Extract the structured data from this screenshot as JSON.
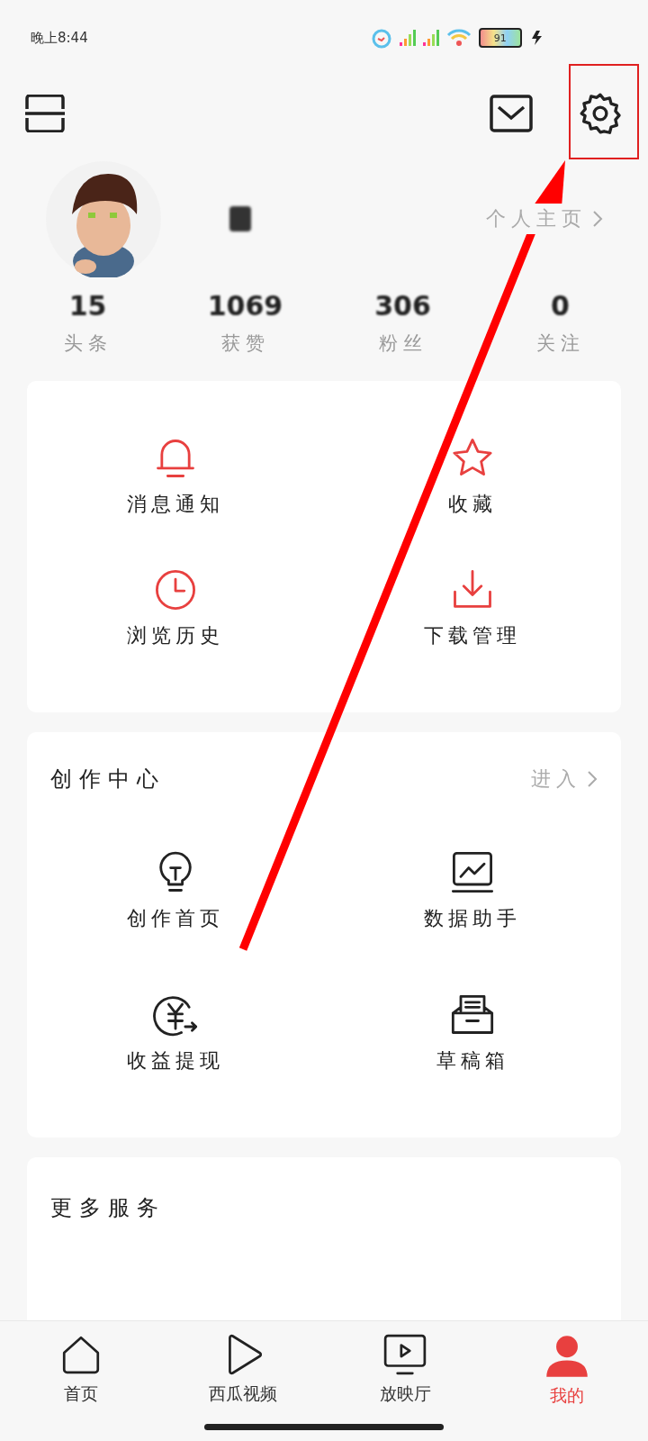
{
  "status_bar": {
    "time": "晚上8:44",
    "battery_label": "91"
  },
  "header": {
    "homepage_link": "个人主页"
  },
  "stats": [
    {
      "value": "15",
      "label": "头条"
    },
    {
      "value": "1069",
      "label": "获赞"
    },
    {
      "value": "306",
      "label": "粉丝"
    },
    {
      "value": "0",
      "label": "关注"
    }
  ],
  "quick_actions": [
    {
      "kind": "bell",
      "label": "消息通知"
    },
    {
      "kind": "star",
      "label": "收藏"
    },
    {
      "kind": "clock",
      "label": "浏览历史"
    },
    {
      "kind": "download",
      "label": "下载管理"
    }
  ],
  "creator_center": {
    "title": "创作中心",
    "enter_link": "进入",
    "items": [
      {
        "kind": "bulb",
        "label": "创作首页"
      },
      {
        "kind": "chart",
        "label": "数据助手"
      },
      {
        "kind": "yuan",
        "label": "收益提现"
      },
      {
        "kind": "drafts",
        "label": "草稿箱"
      }
    ]
  },
  "more_services": {
    "title": "更多服务"
  },
  "tab_bar": [
    {
      "kind": "home",
      "label": "首页",
      "selected": false
    },
    {
      "kind": "play",
      "label": "西瓜视频",
      "selected": false
    },
    {
      "kind": "tv",
      "label": "放映厅",
      "selected": false
    },
    {
      "kind": "user",
      "label": "我的",
      "selected": true
    }
  ]
}
